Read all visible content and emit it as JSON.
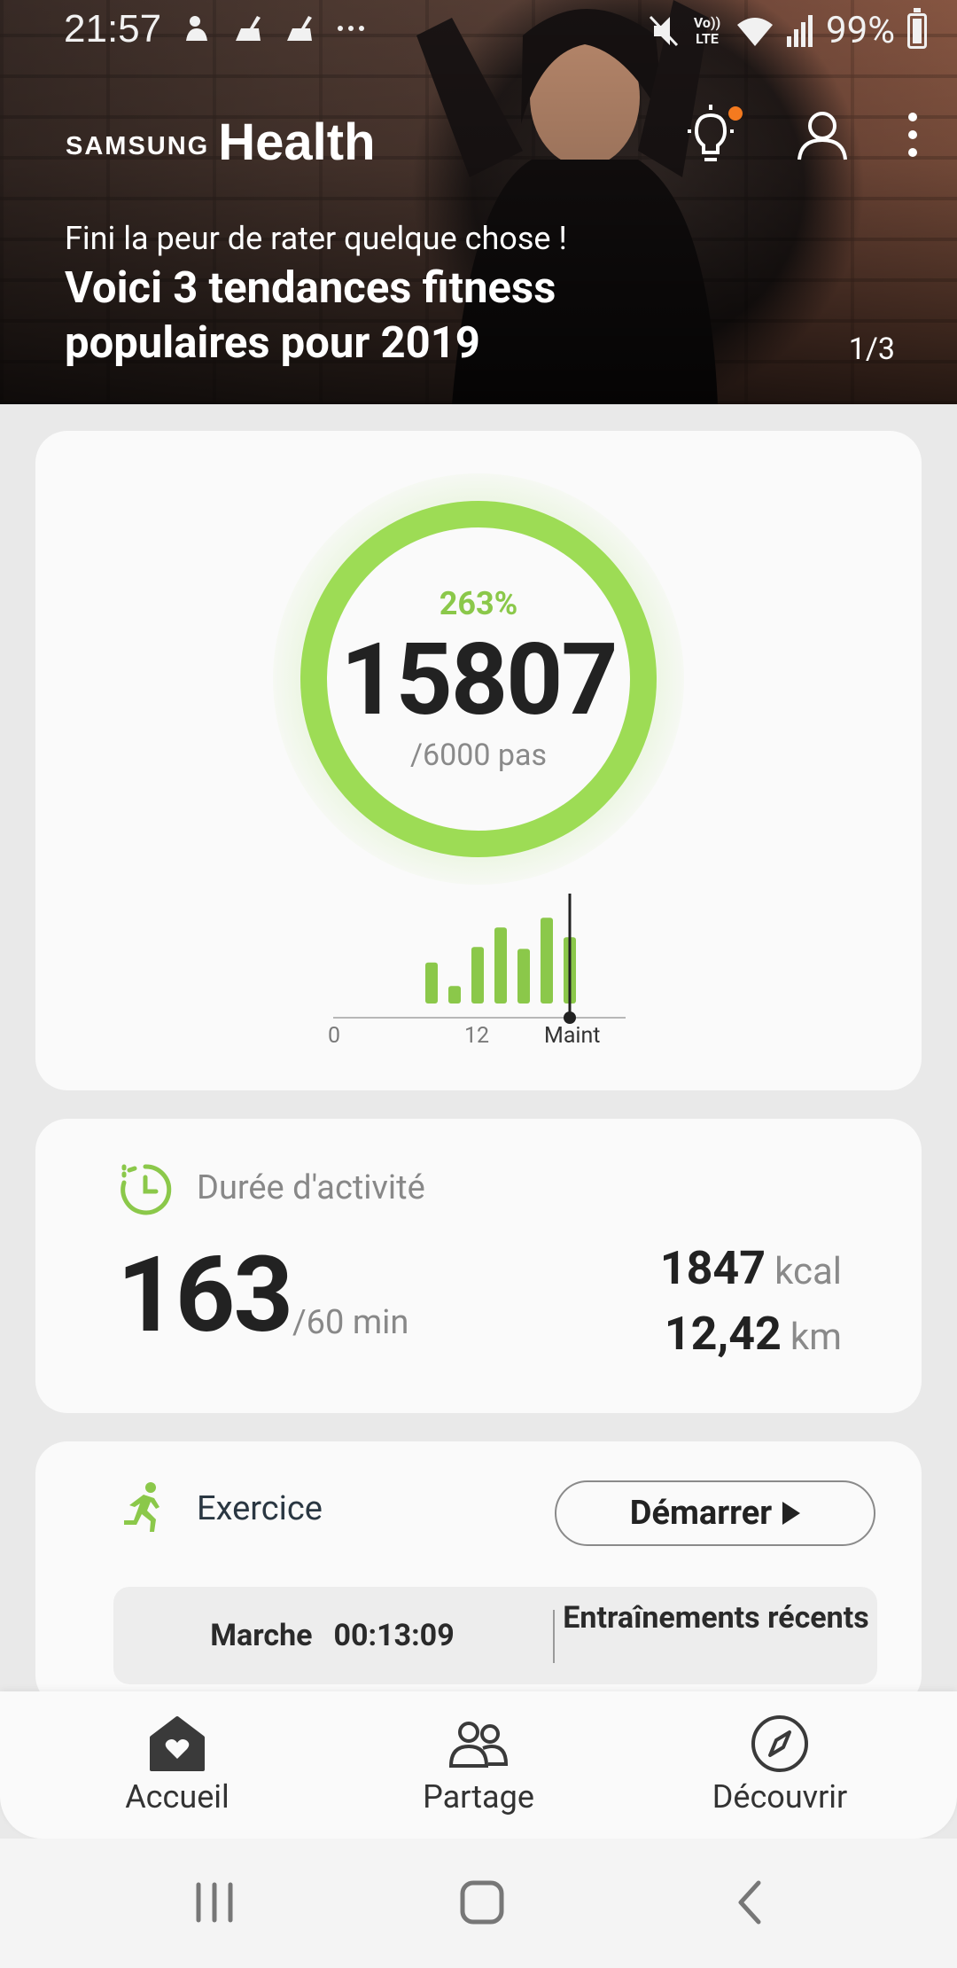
{
  "status_bar": {
    "time": "21:57",
    "network_label": "Vo)) LTE",
    "battery": "99%"
  },
  "header": {
    "brand_samsung": "SAMSUNG",
    "brand_health": "Health",
    "banner_subtitle": "Fini la peur de rater quelque chose !",
    "banner_title": "Voici 3 tendances fitness populaires pour 2019",
    "pager": "1/3",
    "colors": {
      "notification_dot": "#f47a1f"
    }
  },
  "steps": {
    "percent": "263%",
    "count": "15807",
    "goal": "/6000 pas",
    "progress_fraction": 1.0,
    "hourly_bars": [
      0.42,
      0.18,
      0.58,
      0.78,
      0.56,
      0.88,
      0.68
    ],
    "axis_ticks": [
      "0",
      "12",
      "Maint"
    ],
    "colors": {
      "ring": "#9ddc55",
      "bars": "#8bc84a"
    }
  },
  "activity": {
    "label": "Durée d'activité",
    "value": "163",
    "goal": "/60 min",
    "kcal_value": "1847",
    "kcal_unit": "kcal",
    "km_value": "12,42",
    "km_unit": "km"
  },
  "exercise": {
    "label": "Exercice",
    "start_button": "Démarrer",
    "recent_type": "Marche",
    "recent_time": "00:13:09",
    "recent_link": "Entraînements récents"
  },
  "bottom_nav": {
    "items": [
      {
        "label": "Accueil",
        "icon": "home-heart-icon"
      },
      {
        "label": "Partage",
        "icon": "people-icon"
      },
      {
        "label": "Découvrir",
        "icon": "compass-icon"
      }
    ]
  },
  "system_nav": {
    "icons": [
      "recent-apps-icon",
      "home-icon",
      "back-icon"
    ]
  }
}
